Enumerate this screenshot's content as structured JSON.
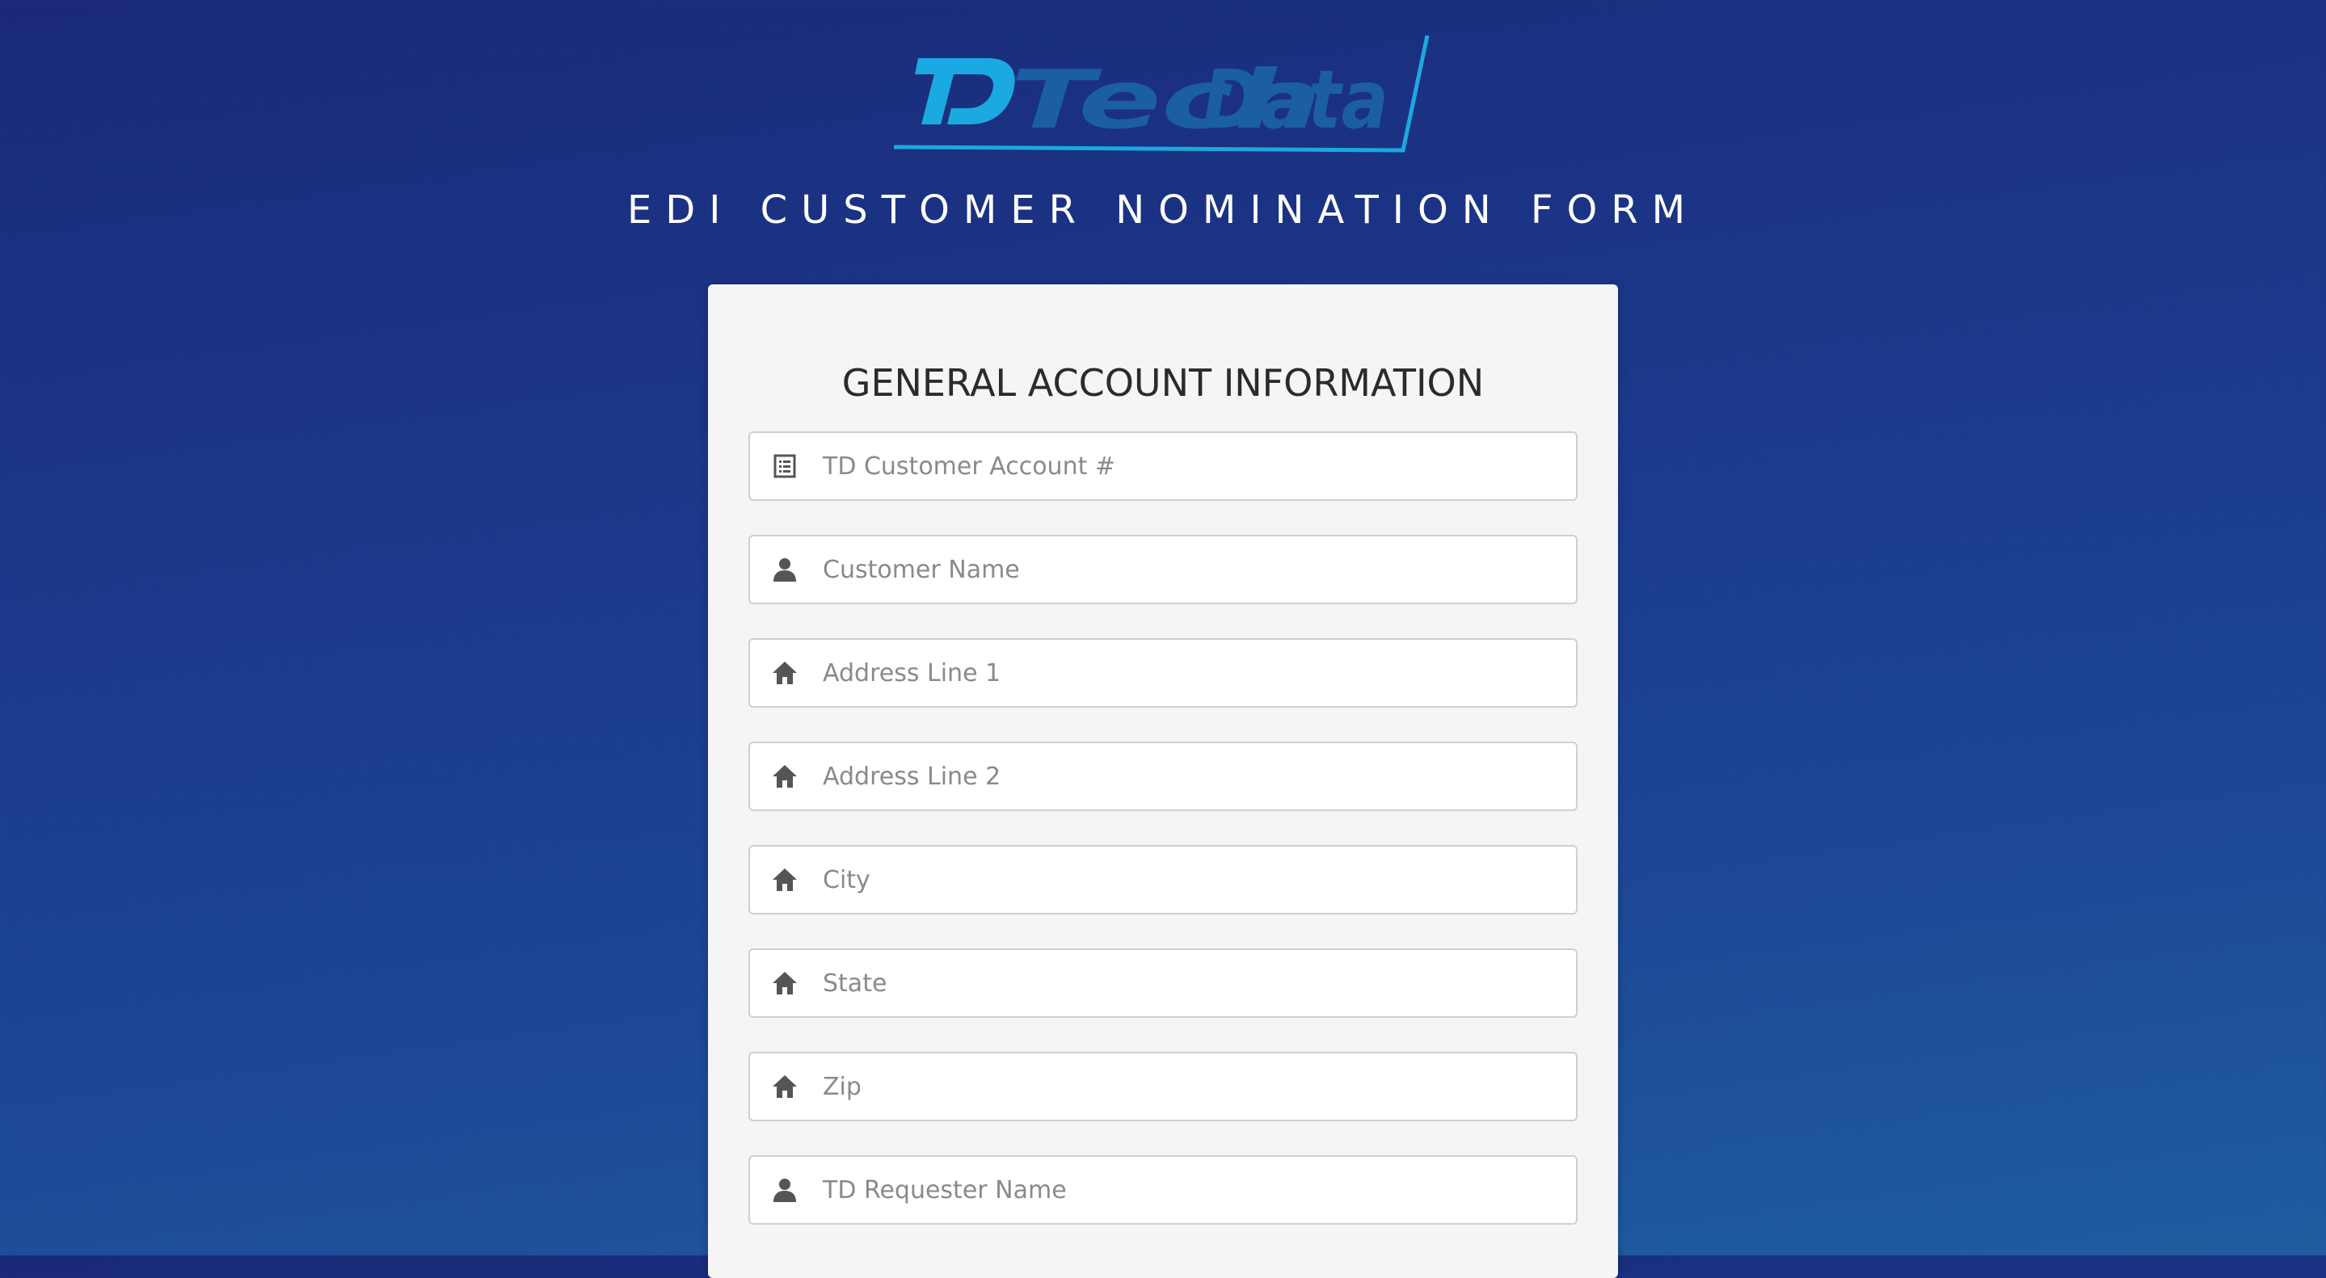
{
  "brand": {
    "logo_text": "Tech Data",
    "logo_mark": "TD",
    "colors": {
      "logo_dark": "#1b5ea3",
      "logo_light": "#1aa9e0"
    }
  },
  "header": {
    "title": "EDI CUSTOMER NOMINATION FORM"
  },
  "form": {
    "section_title": "GENERAL ACCOUNT INFORMATION",
    "fields": [
      {
        "icon": "list-icon",
        "placeholder": "TD Customer Account #",
        "value": ""
      },
      {
        "icon": "user-icon",
        "placeholder": "Customer Name",
        "value": ""
      },
      {
        "icon": "home-icon",
        "placeholder": "Address Line 1",
        "value": ""
      },
      {
        "icon": "home-icon",
        "placeholder": "Address Line 2",
        "value": ""
      },
      {
        "icon": "home-icon",
        "placeholder": "City",
        "value": ""
      },
      {
        "icon": "home-icon",
        "placeholder": "State",
        "value": ""
      },
      {
        "icon": "home-icon",
        "placeholder": "Zip",
        "value": ""
      },
      {
        "icon": "user-icon",
        "placeholder": "TD Requester Name",
        "value": ""
      }
    ]
  }
}
